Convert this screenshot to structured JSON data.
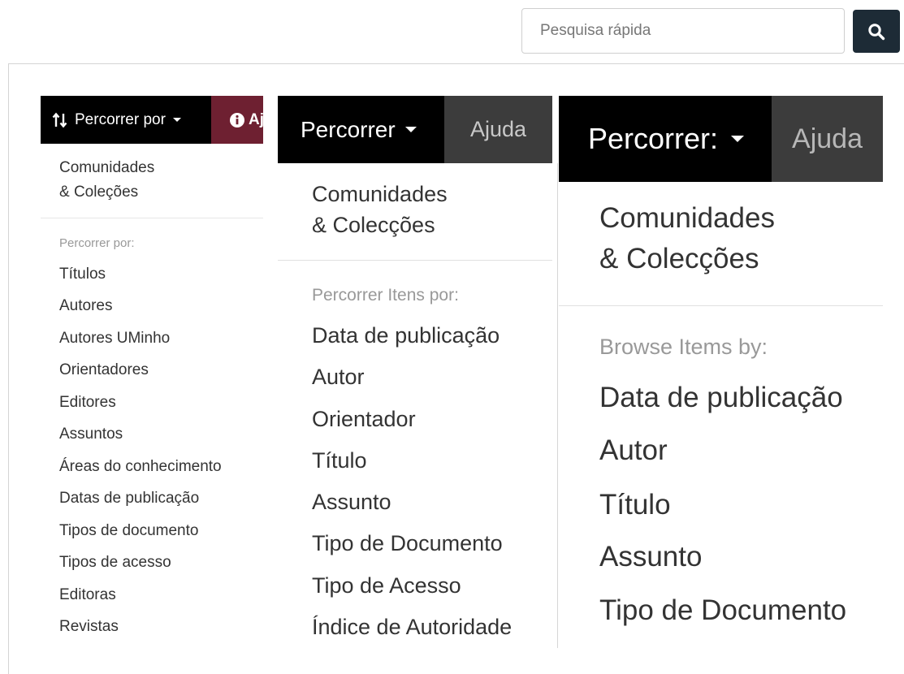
{
  "search": {
    "placeholder": "Pesquisa rápida",
    "button_icon": "search-icon"
  },
  "panel1": {
    "browse_label": "Percorrer por",
    "help_label": "Aj",
    "communities_line1": "Comunidades",
    "communities_line2": "& Coleções",
    "section_label": "Percorrer por:",
    "items": [
      "Títulos",
      "Autores",
      "Autores UMinho",
      "Orientadores",
      "Editores",
      "Assuntos",
      "Áreas do conhecimento",
      "Datas de publicação",
      "Tipos de documento",
      "Tipos de acesso",
      "Editoras",
      "Revistas"
    ],
    "colors": {
      "bar": "#000000",
      "help_bar": "#6e2031"
    }
  },
  "panel2": {
    "browse_label": "Percorrer",
    "help_label": "Ajuda",
    "communities_line1": "Comunidades",
    "communities_line2": "& Colecções",
    "section_label": "Percorrer Itens por:",
    "items": [
      "Data de publicação",
      "Autor",
      "Orientador",
      "Título",
      "Assunto",
      "Tipo de Documento",
      "Tipo de Acesso",
      "Índice de Autoridade"
    ],
    "colors": {
      "bar": "#000000",
      "help_bar": "#3c3c3c"
    }
  },
  "panel3": {
    "browse_label": "Percorrer:",
    "help_label": "Ajuda",
    "communities_line1": "Comunidades",
    "communities_line2": "& Colecções",
    "section_label": "Browse Items by:",
    "items": [
      "Data de publicação",
      "Autor",
      "Título",
      "Assunto",
      "Tipo de Documento"
    ],
    "colors": {
      "bar": "#000000",
      "help_bar": "#3c3c3c"
    }
  }
}
